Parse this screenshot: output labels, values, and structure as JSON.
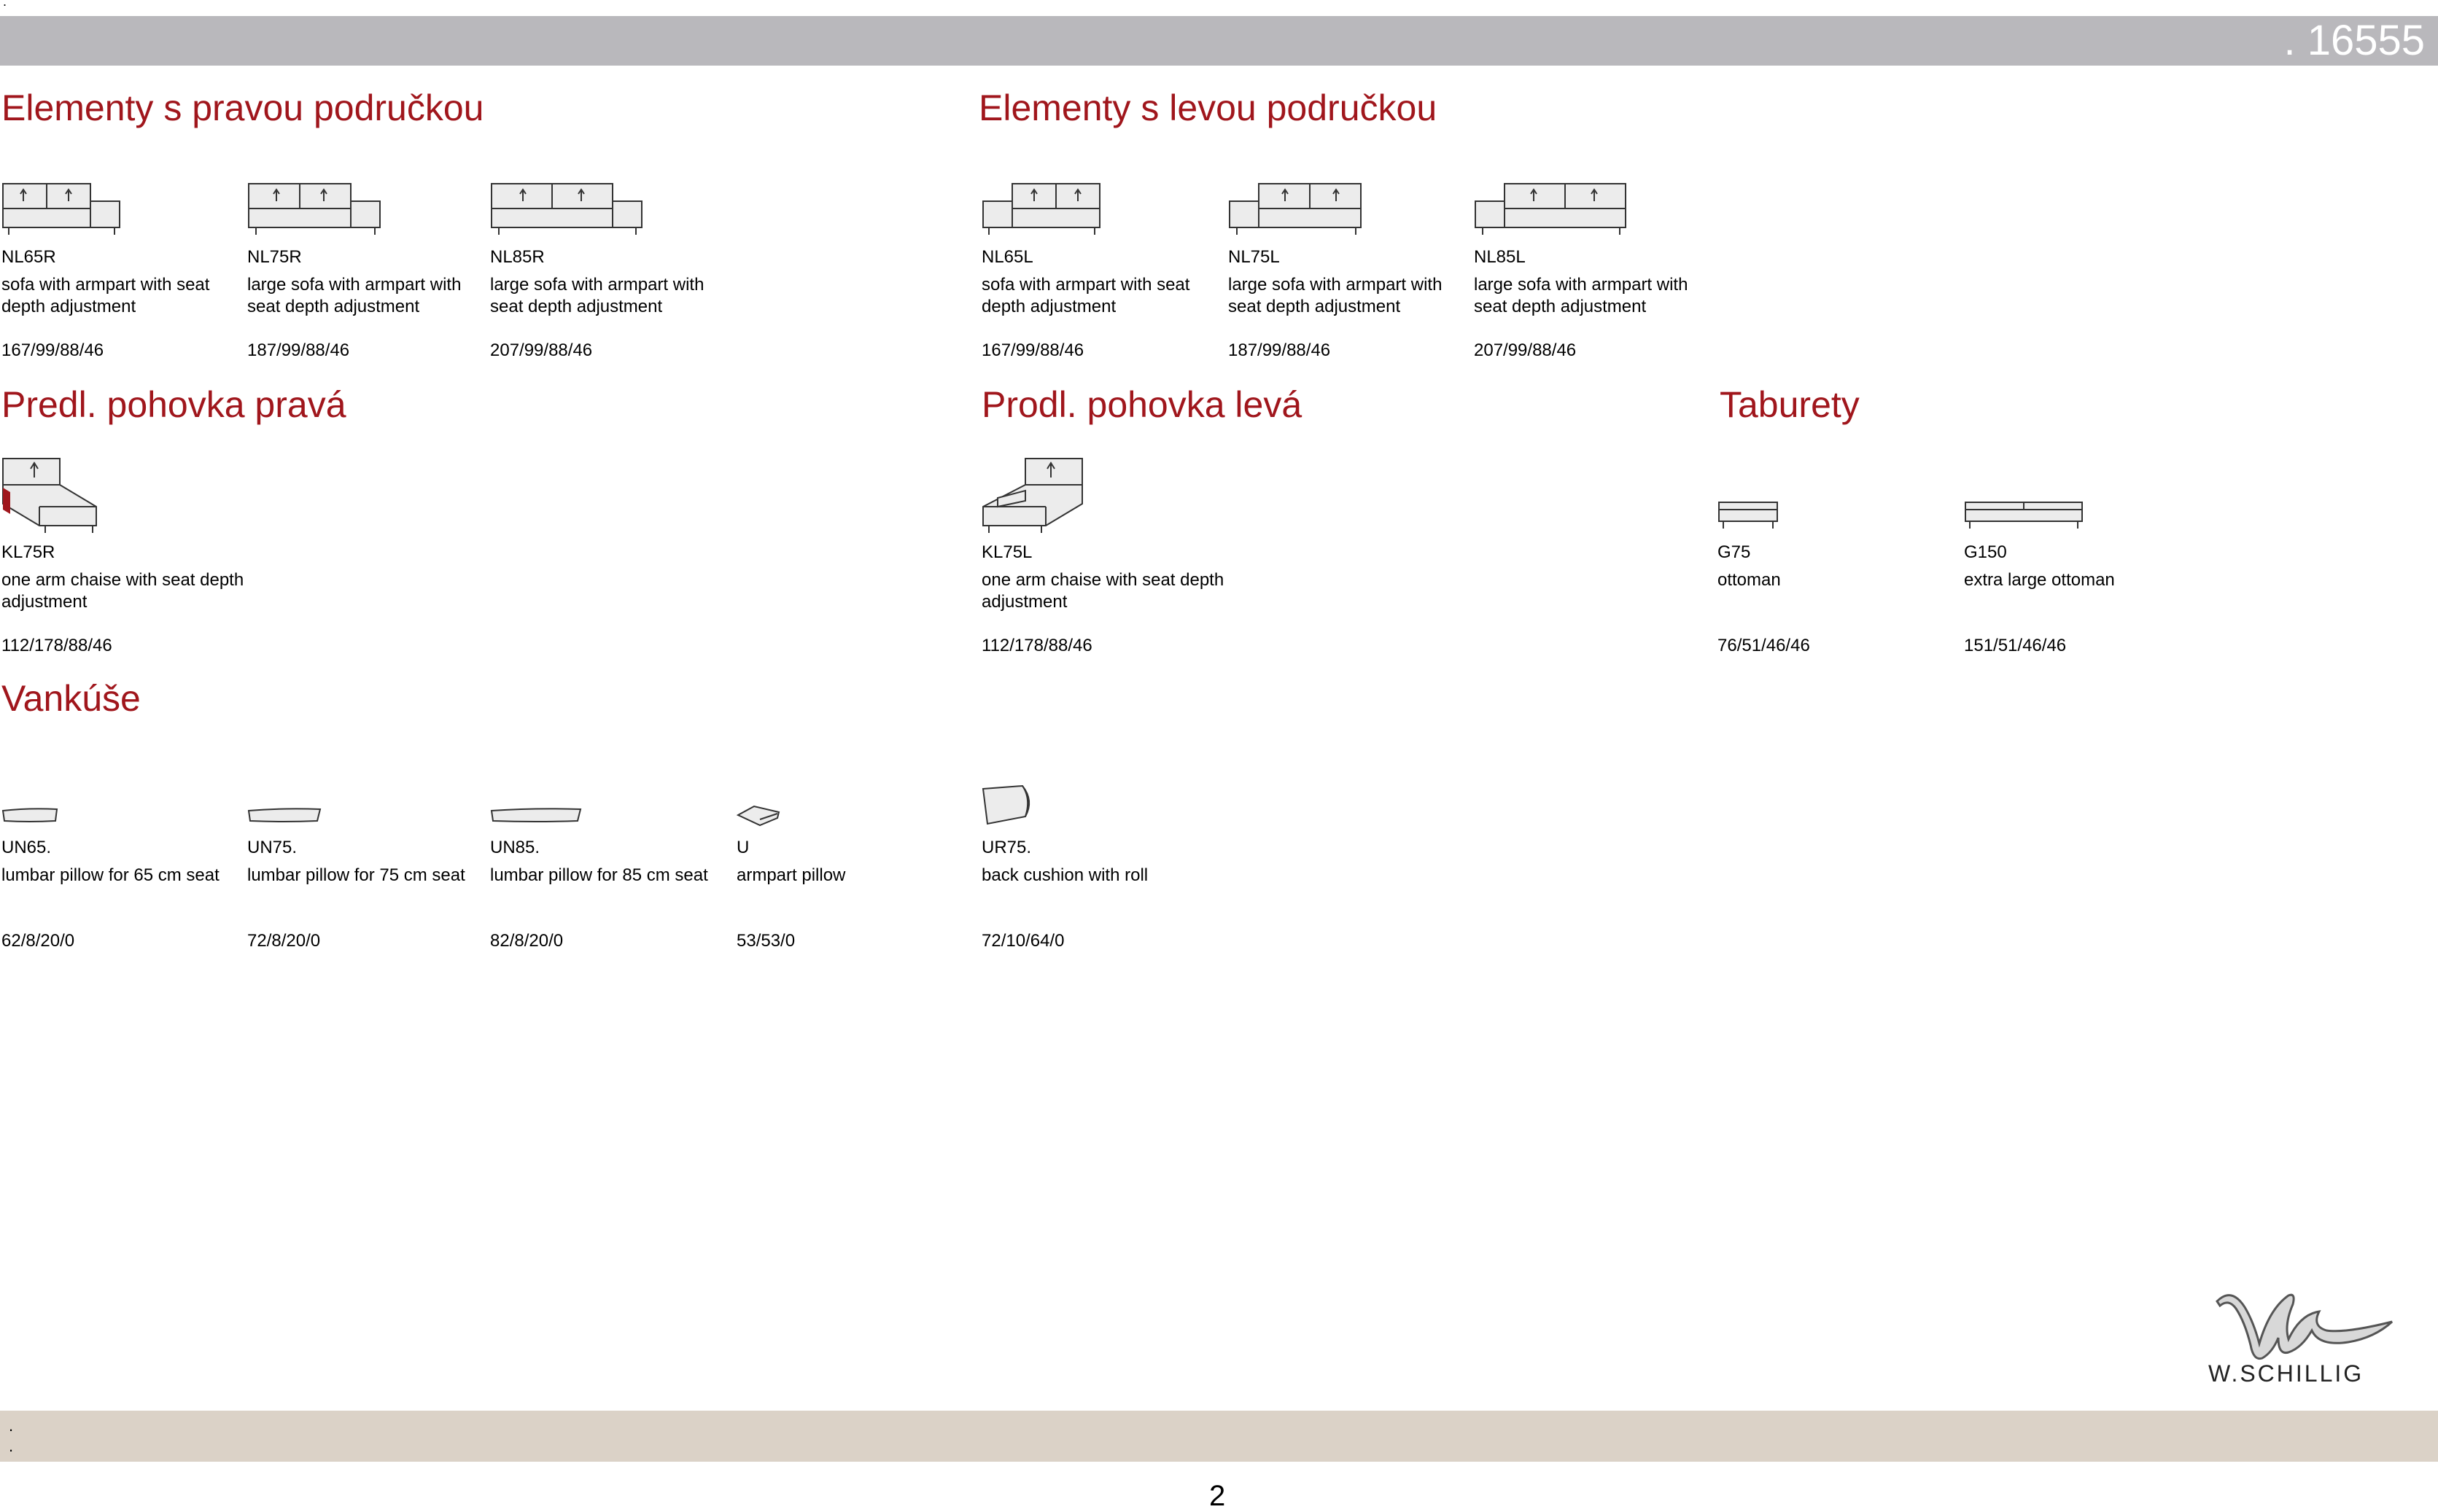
{
  "header": {
    "top_mark": ".",
    "code": ". 16555"
  },
  "sections": {
    "right_armrest": {
      "title": "Elementy s pravou područkou"
    },
    "left_armrest": {
      "title": "Elementy s levou područkou"
    },
    "chaise_right": {
      "title": "Predl. pohovka pravá"
    },
    "chaise_left": {
      "title": "Prodl. pohovka levá"
    },
    "ottomans": {
      "title": "Taburety"
    },
    "pillows": {
      "title": "Vankúše"
    }
  },
  "items": {
    "nl65r": {
      "name": "NL65R",
      "desc": "sofa with armpart with seat depth adjustment",
      "dims": "167/99/88/46",
      "icon": "sofa-right-armrest-icon"
    },
    "nl75r": {
      "name": "NL75R",
      "desc": "large sofa with armpart with seat depth adjustment",
      "dims": "187/99/88/46",
      "icon": "sofa-right-armrest-icon"
    },
    "nl85r": {
      "name": "NL85R",
      "desc": "large sofa with armpart with seat depth adjustment",
      "dims": "207/99/88/46",
      "icon": "sofa-right-armrest-icon"
    },
    "nl65l": {
      "name": "NL65L",
      "desc": "sofa with armpart with seat depth adjustment",
      "dims": "167/99/88/46",
      "icon": "sofa-left-armrest-icon"
    },
    "nl75l": {
      "name": "NL75L",
      "desc": "large sofa with armpart with seat depth adjustment",
      "dims": "187/99/88/46",
      "icon": "sofa-left-armrest-icon"
    },
    "nl85l": {
      "name": "NL85L",
      "desc": "large sofa with armpart with seat depth adjustment",
      "dims": "207/99/88/46",
      "icon": "sofa-left-armrest-icon"
    },
    "kl75r": {
      "name": "KL75R",
      "desc": "one arm chaise with seat depth adjustment",
      "dims": "112/178/88/46",
      "icon": "chaise-right-icon"
    },
    "kl75l": {
      "name": "KL75L",
      "desc": "one arm chaise with seat depth adjustment",
      "dims": "112/178/88/46",
      "icon": "chaise-left-icon"
    },
    "g75": {
      "name": "G75",
      "desc": "ottoman",
      "dims": "76/51/46/46",
      "icon": "ottoman-icon"
    },
    "g150": {
      "name": "G150",
      "desc": "extra large ottoman",
      "dims": "151/51/46/46",
      "icon": "ottoman-large-icon"
    },
    "un65": {
      "name": "UN65.",
      "desc": "lumbar pillow for 65 cm seat",
      "dims": "62/8/20/0",
      "icon": "lumbar-pillow-icon"
    },
    "un75": {
      "name": "UN75.",
      "desc": "lumbar pillow for 75 cm seat",
      "dims": "72/8/20/0",
      "icon": "lumbar-pillow-icon"
    },
    "un85": {
      "name": "UN85.",
      "desc": "lumbar pillow for 85 cm seat",
      "dims": "82/8/20/0",
      "icon": "lumbar-pillow-icon"
    },
    "u": {
      "name": "U",
      "desc": "armpart pillow",
      "dims": "53/53/0",
      "icon": "armpart-pillow-icon"
    },
    "ur75": {
      "name": "UR75.",
      "desc": "back cushion with roll",
      "dims": "72/10/64/0",
      "icon": "back-cushion-icon"
    }
  },
  "brand": {
    "logo": "W.SCHILLIG",
    "icon": "w-schillig-logo-icon"
  },
  "footer": {
    "line1": ".",
    "line2": "."
  },
  "page_number": "2",
  "colors": {
    "heading": "#a0161c",
    "top_bar": "#b9b8bc",
    "footer_bar": "#dbd2c7"
  }
}
